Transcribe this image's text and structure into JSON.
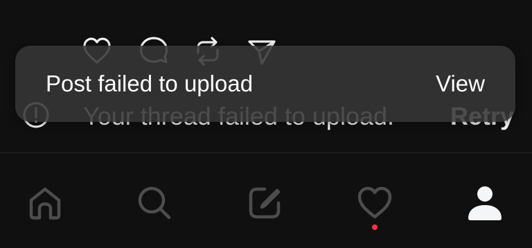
{
  "toast": {
    "message": "Post failed to upload",
    "action_label": "View"
  },
  "failed_row": {
    "text": "Your thread failed to upload.",
    "retry_label": "Retry"
  },
  "post_actions": [
    {
      "icon": "heart-icon"
    },
    {
      "icon": "comment-icon"
    },
    {
      "icon": "repost-icon"
    },
    {
      "icon": "share-icon"
    }
  ],
  "bottom_nav": [
    {
      "name": "home",
      "icon": "home-icon"
    },
    {
      "name": "search",
      "icon": "search-icon"
    },
    {
      "name": "compose",
      "icon": "compose-icon"
    },
    {
      "name": "activity",
      "icon": "heart-icon",
      "has_notification": true
    },
    {
      "name": "profile",
      "icon": "profile-icon",
      "active": true
    }
  ],
  "colors": {
    "background": "#101010",
    "toast_bg": "#363636",
    "text": "#f3f5f7",
    "icon_inactive": "#4d4d4d",
    "icon_active": "#f3f5f7",
    "notification_dot": "#ff3040"
  }
}
